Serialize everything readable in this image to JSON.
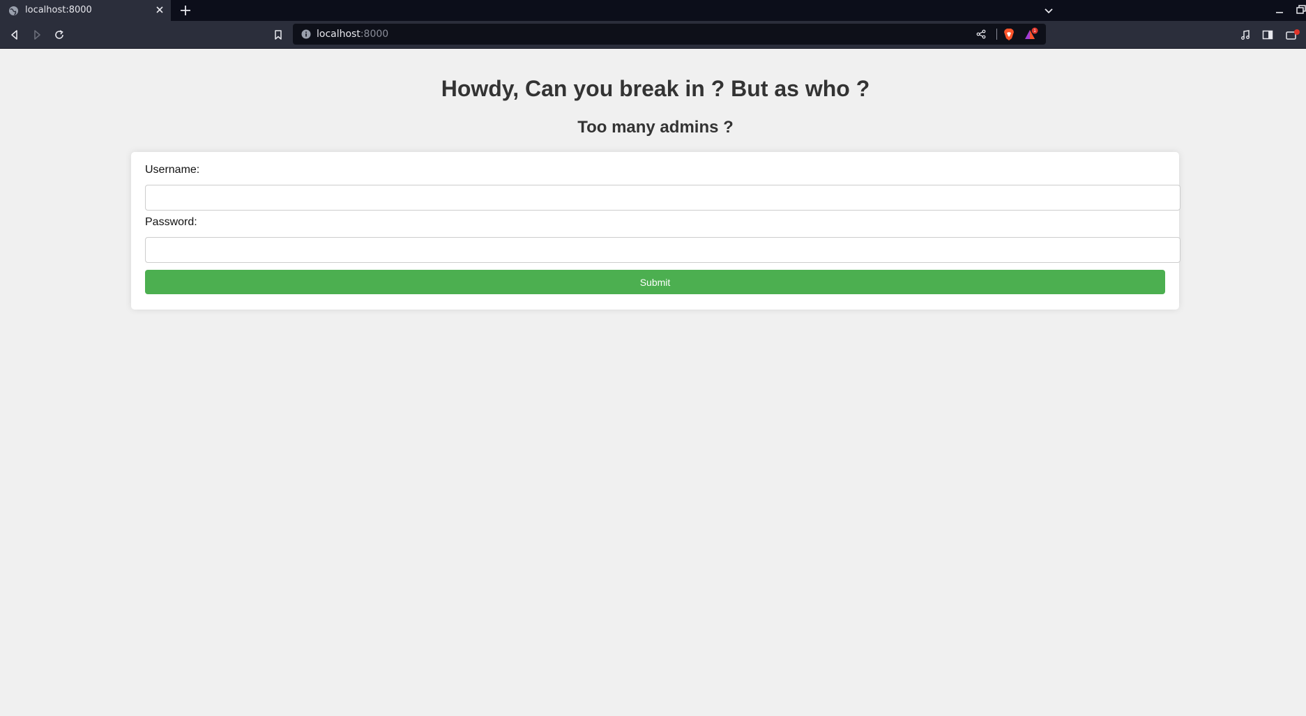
{
  "browser": {
    "tab": {
      "title": "localhost:8000"
    },
    "address_bar": {
      "host": "localhost",
      "port": ":8000"
    },
    "badge_count": "1"
  },
  "page": {
    "heading": "Howdy, Can you break in ? But as who ?",
    "subheading": "Too many admins ?",
    "form": {
      "username_label": "Username:",
      "username_value": "",
      "password_label": "Password:",
      "password_value": "",
      "submit_label": "Submit"
    }
  },
  "colors": {
    "submit": "#4caf50",
    "page_bg": "#f0f0f0",
    "text": "#333333"
  }
}
